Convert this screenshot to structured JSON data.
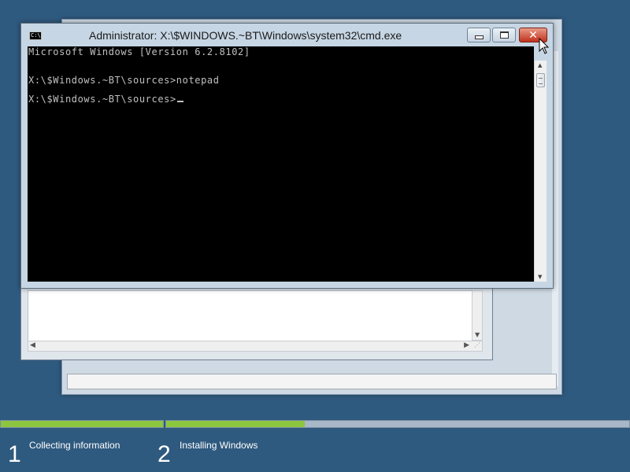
{
  "cmd_window": {
    "title": "Administrator: X:\\$WINDOWS.~BT\\Windows\\system32\\cmd.exe",
    "icon": "cmd-icon",
    "console_lines": [
      "Microsoft Windows [Version 6.2.8102]",
      "",
      "X:\\$Windows.~BT\\sources>notepad",
      "",
      "X:\\$Windows.~BT\\sources>"
    ],
    "colors": {
      "background": "#000000",
      "text": "#c0c0c0",
      "close_button": "#c1311b"
    }
  },
  "setup_progress": {
    "steps": [
      {
        "number": "1",
        "label": "Collecting information",
        "progress": 1.0
      },
      {
        "number": "2",
        "label": "Installing Windows",
        "progress": 0.3
      }
    ],
    "colors": {
      "fill": "#8dc63f",
      "track": "#a8b8c8",
      "desktop": "#2f5a7f"
    }
  }
}
